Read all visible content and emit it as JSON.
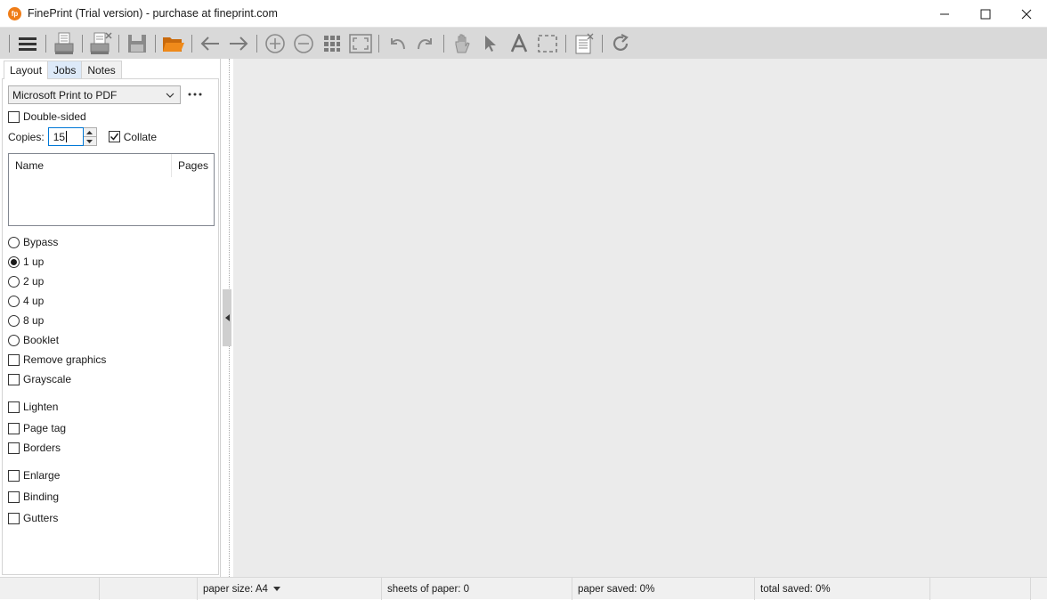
{
  "window": {
    "title": "FinePrint (Trial version) - purchase at fineprint.com",
    "app_icon_glyph": "fp",
    "controls": [
      "minimize-icon",
      "maximize-icon",
      "close-icon"
    ]
  },
  "toolbar": {
    "buttons": [
      "menu-icon",
      "print-icon",
      "print-close-icon",
      "save-icon",
      "open-folder-icon",
      "back-arrow-icon",
      "forward-arrow-icon",
      "zoom-in-icon",
      "zoom-out-icon",
      "thumbnails-icon",
      "fit-page-icon",
      "undo-icon",
      "redo-icon",
      "hand-icon",
      "pointer-icon",
      "text-icon",
      "select-area-icon",
      "stationery-icon",
      "refresh-icon"
    ],
    "accent_color": "#ef8a1a"
  },
  "tabs": [
    {
      "label": "Layout",
      "active": true
    },
    {
      "label": "Jobs",
      "active": false
    },
    {
      "label": "Notes",
      "active": false
    }
  ],
  "layout": {
    "printer": "Microsoft Print to PDF",
    "double_sided_label": "Double-sided",
    "double_sided": false,
    "copies_label": "Copies:",
    "copies_value": "15",
    "collate_label": "Collate",
    "collate": true,
    "jobs_columns": {
      "name": "Name",
      "pages": "Pages"
    },
    "radios": [
      {
        "label": "Bypass",
        "checked": false
      },
      {
        "label": "1 up",
        "checked": true
      },
      {
        "label": "2 up",
        "checked": false
      },
      {
        "label": "4 up",
        "checked": false
      },
      {
        "label": "8 up",
        "checked": false
      },
      {
        "label": "Booklet",
        "checked": false
      }
    ],
    "checks": [
      {
        "label": "Remove graphics",
        "checked": false
      },
      {
        "label": "Grayscale",
        "checked": false
      },
      {
        "label": "Lighten",
        "checked": false
      },
      {
        "label": "Page tag",
        "checked": false
      },
      {
        "label": "Borders",
        "checked": false
      },
      {
        "label": "Enlarge",
        "checked": false
      },
      {
        "label": "Binding",
        "checked": false
      },
      {
        "label": "Gutters",
        "checked": false
      }
    ]
  },
  "status": {
    "paper_size": "paper size: A4",
    "sheets": "sheets of paper: 0",
    "paper_saved": "paper saved: 0%",
    "total_saved": "total saved: 0%"
  }
}
